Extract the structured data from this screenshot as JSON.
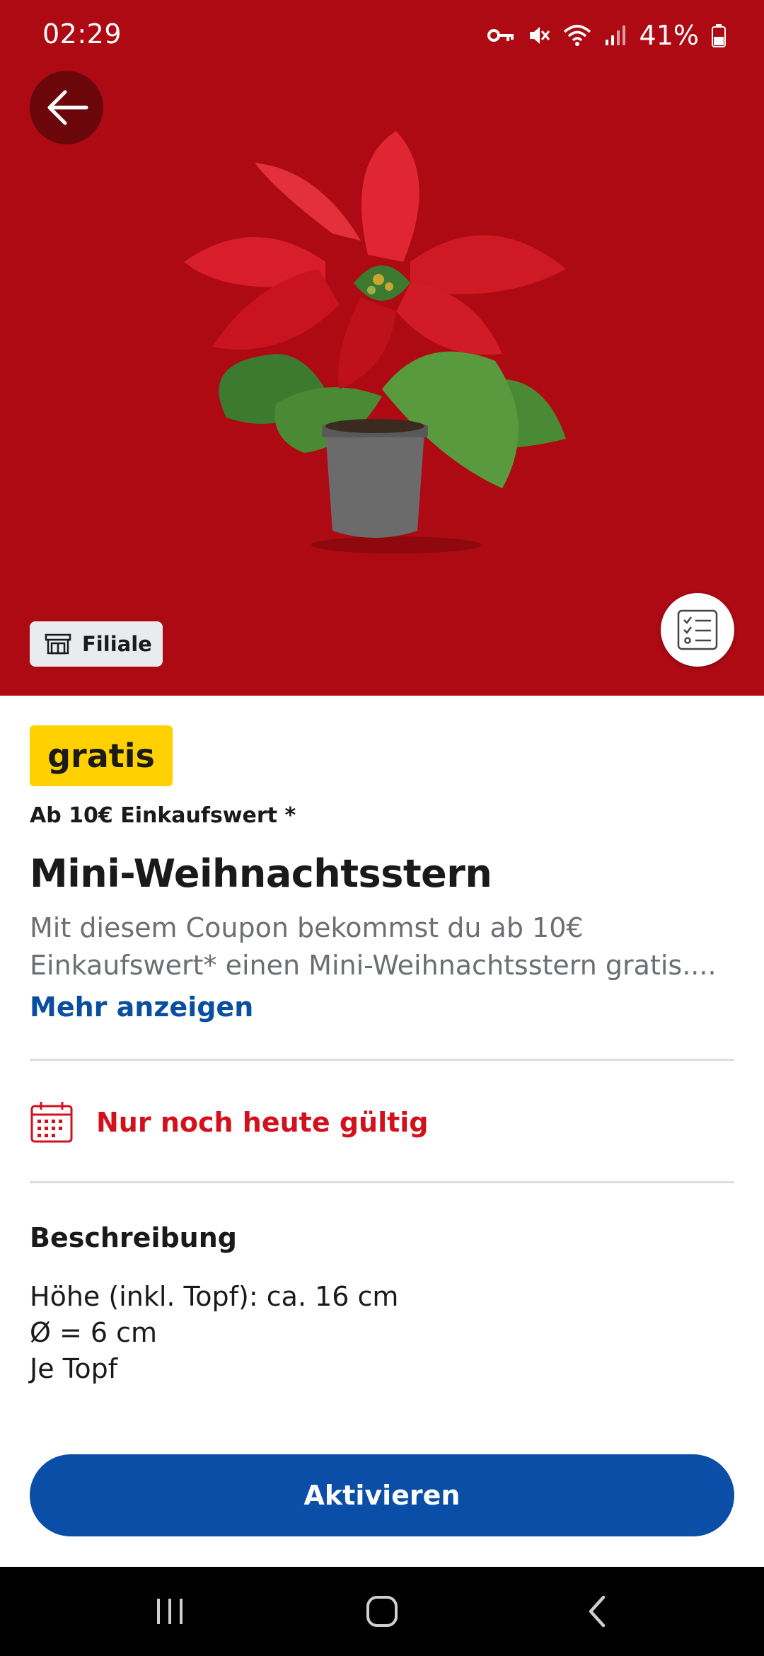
{
  "status_bar": {
    "time": "02:29",
    "battery": "41%",
    "icons": [
      "key-icon",
      "mute-icon",
      "wifi-icon",
      "signal-icon",
      "battery-icon"
    ]
  },
  "hero": {
    "background_color": "#ad0a13",
    "image": "poinsettia-plant",
    "store_badge": "Filiale"
  },
  "offer": {
    "price_badge": "gratis",
    "min_purchase": "Ab 10€ Einkaufswert *",
    "title": "Mini-Weihnachtsstern",
    "description": "Mit diesem Coupon bekommst du ab 10€ Einkaufswert* einen Mini-Weihnachtsstern gratis....",
    "more_link": "Mehr anzeigen",
    "validity": "Nur noch heute gültig"
  },
  "description_section": {
    "heading": "Beschreibung",
    "lines": [
      "Höhe (inkl. Topf): ca. 16 cm",
      "Ø = 6 cm",
      "Je Topf"
    ]
  },
  "actions": {
    "activate_label": "Aktivieren"
  },
  "colors": {
    "accent_blue": "#0a4ea8",
    "badge_yellow": "#ffd100",
    "warning_red": "#d3111c"
  }
}
